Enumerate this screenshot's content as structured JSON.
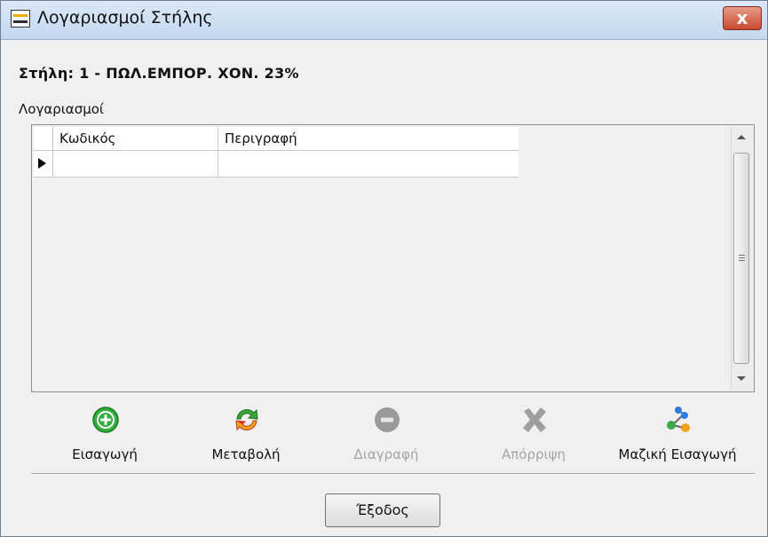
{
  "window": {
    "title": "Λογαριασμοί Στήλης",
    "close_symbol": "x"
  },
  "heading": {
    "text": "Στήλη:  1 - ΠΩΛ.ΕΜΠΟΡ. ΧΟΝ.   23%"
  },
  "accounts": {
    "label": "Λογαριασμοί",
    "columns": [
      "Κωδικός",
      "Περιγραφή"
    ],
    "rows": [
      {
        "code": "",
        "description": ""
      }
    ]
  },
  "toolbar": {
    "insert_label": "Εισαγωγή",
    "modify_label": "Μεταβολή",
    "delete_label": "Διαγραφή",
    "reject_label": "Απόρριψη",
    "bulk_insert_label": "Μαζική Εισαγωγή"
  },
  "footer": {
    "exit_label": "Έξοδος"
  }
}
